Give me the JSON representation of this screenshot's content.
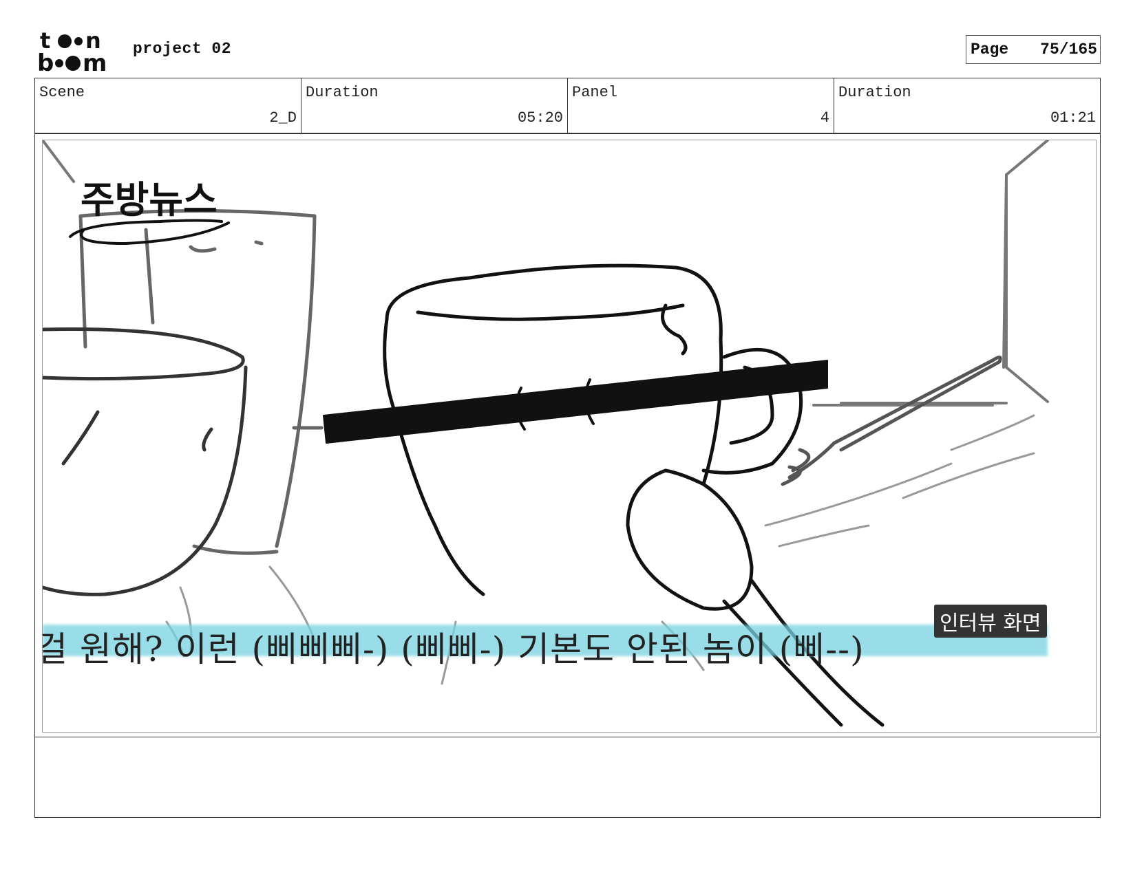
{
  "header": {
    "logo_text": [
      "toon",
      "boom"
    ],
    "project_title": "project 02",
    "page_label": "Page",
    "page_value": "75/165"
  },
  "info": {
    "scene_label": "Scene",
    "scene_value": "2_D",
    "scene_duration_label": "Duration",
    "scene_duration_value": "05:20",
    "panel_label": "Panel",
    "panel_value": "4",
    "panel_duration_label": "Duration",
    "panel_duration_value": "01:21"
  },
  "panel": {
    "handwritten_title": "주방뉴스",
    "subtitle": "걸 원해? 이런 (삐삐삐-) (삐삐-) 기본도 안된 놈이 (삐--)",
    "overlay_label": "인터뷰 화면",
    "subtitle_highlight_color": "#78d2e1"
  },
  "notes": {
    "text": ""
  }
}
